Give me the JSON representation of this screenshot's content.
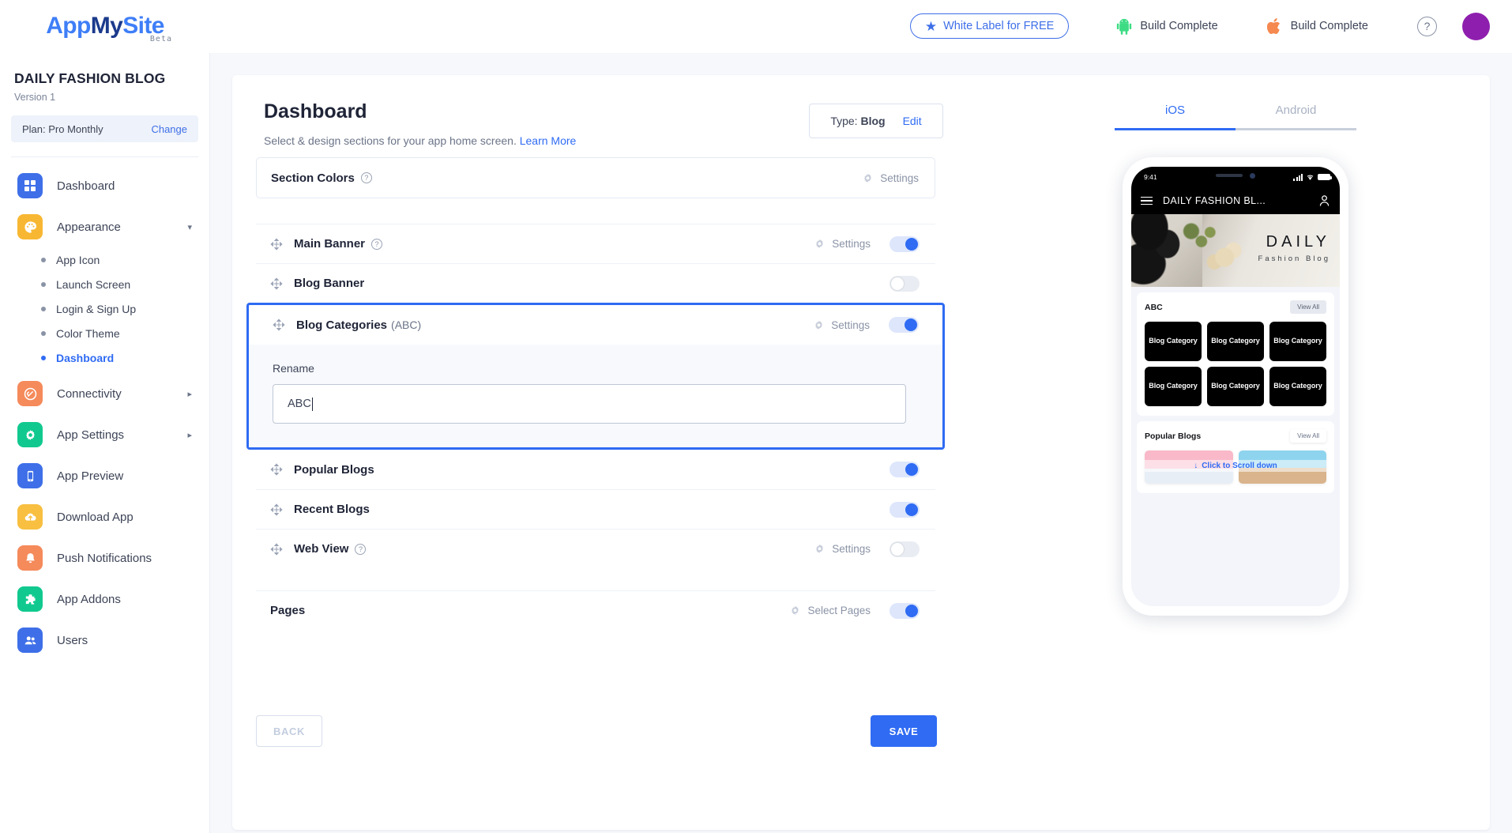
{
  "brand": {
    "logo_app": "App",
    "logo_my": "My",
    "logo_site": "Site",
    "beta": "Beta"
  },
  "topbar": {
    "white_label": "White Label for FREE",
    "android_build": "Build Complete",
    "ios_build": "Build Complete",
    "help": "?"
  },
  "sidebar": {
    "site_title": "DAILY FASHION BLOG",
    "version": "Version 1",
    "plan_label": "Plan: Pro Monthly",
    "plan_change": "Change",
    "items": [
      {
        "label": "Dashboard",
        "icon": "grid-icon",
        "color": "#3e6fe8"
      },
      {
        "label": "Appearance",
        "icon": "palette-icon",
        "color": "#f8b733"
      },
      {
        "label": "Connectivity",
        "icon": "link-icon",
        "color": "#f58a5b"
      },
      {
        "label": "App Settings",
        "icon": "gear-icon",
        "color": "#11c98e"
      },
      {
        "label": "App Preview",
        "icon": "phone-icon",
        "color": "#3e6fe8"
      },
      {
        "label": "Download App",
        "icon": "cloud-upload-icon",
        "color": "#f8bf40"
      },
      {
        "label": "Push Notifications",
        "icon": "bell-icon",
        "color": "#f58a5b"
      },
      {
        "label": "App Addons",
        "icon": "puzzle-icon",
        "color": "#11c98e"
      },
      {
        "label": "Users",
        "icon": "users-icon",
        "color": "#3e6fe8"
      }
    ],
    "appearance_sub": [
      {
        "label": "App Icon",
        "active": false
      },
      {
        "label": "Launch Screen",
        "active": false
      },
      {
        "label": "Login & Sign Up",
        "active": false
      },
      {
        "label": "Color Theme",
        "active": false
      },
      {
        "label": "Dashboard",
        "active": true
      }
    ]
  },
  "main": {
    "title": "Dashboard",
    "subtitle": "Select & design sections for your app home screen.",
    "learn_more": "Learn More",
    "type_label": "Type:",
    "type_value": "Blog",
    "type_edit": "Edit",
    "section_colors": {
      "label": "Section Colors",
      "settings": "Settings"
    },
    "rows": [
      {
        "label": "Main Banner",
        "has_help": true,
        "settings": "Settings",
        "toggle": "on"
      },
      {
        "label": "Blog Banner",
        "has_help": false,
        "settings": null,
        "toggle": "off"
      }
    ],
    "blog_categories": {
      "label": "Blog Categories",
      "alias": "(ABC)",
      "settings": "Settings",
      "toggle": "on",
      "rename_label": "Rename",
      "rename_value": "ABC"
    },
    "rows_after": [
      {
        "label": "Popular Blogs",
        "has_help": false,
        "settings": null,
        "toggle": "on"
      },
      {
        "label": "Recent Blogs",
        "has_help": false,
        "settings": null,
        "toggle": "on"
      },
      {
        "label": "Web View",
        "has_help": true,
        "settings": "Settings",
        "toggle": "off"
      }
    ],
    "pages": {
      "label": "Pages",
      "action": "Select Pages",
      "toggle": "on"
    },
    "back_button": "BACK",
    "save_button": "SAVE"
  },
  "preview": {
    "tabs": [
      {
        "label": "iOS",
        "active": true
      },
      {
        "label": "Android",
        "active": false
      }
    ],
    "phone": {
      "time": "9:41",
      "app_title": "DAILY FASHION BL...",
      "banner_title": "DAILY",
      "banner_subtitle": "Fashion Blog",
      "categories_title": "ABC",
      "categories_view_all": "View All",
      "category_tiles": [
        "Blog Category",
        "Blog Category",
        "Blog Category",
        "Blog Category",
        "Blog Category",
        "Blog Category"
      ],
      "popular_title": "Popular Blogs",
      "popular_view_all": "View All",
      "scroll_hint": "Click to Scroll down"
    }
  },
  "colors": {
    "accent": "#2f6bf3",
    "sidebar_active": "#2f6bf3",
    "save_bg": "#2f6bf3"
  }
}
